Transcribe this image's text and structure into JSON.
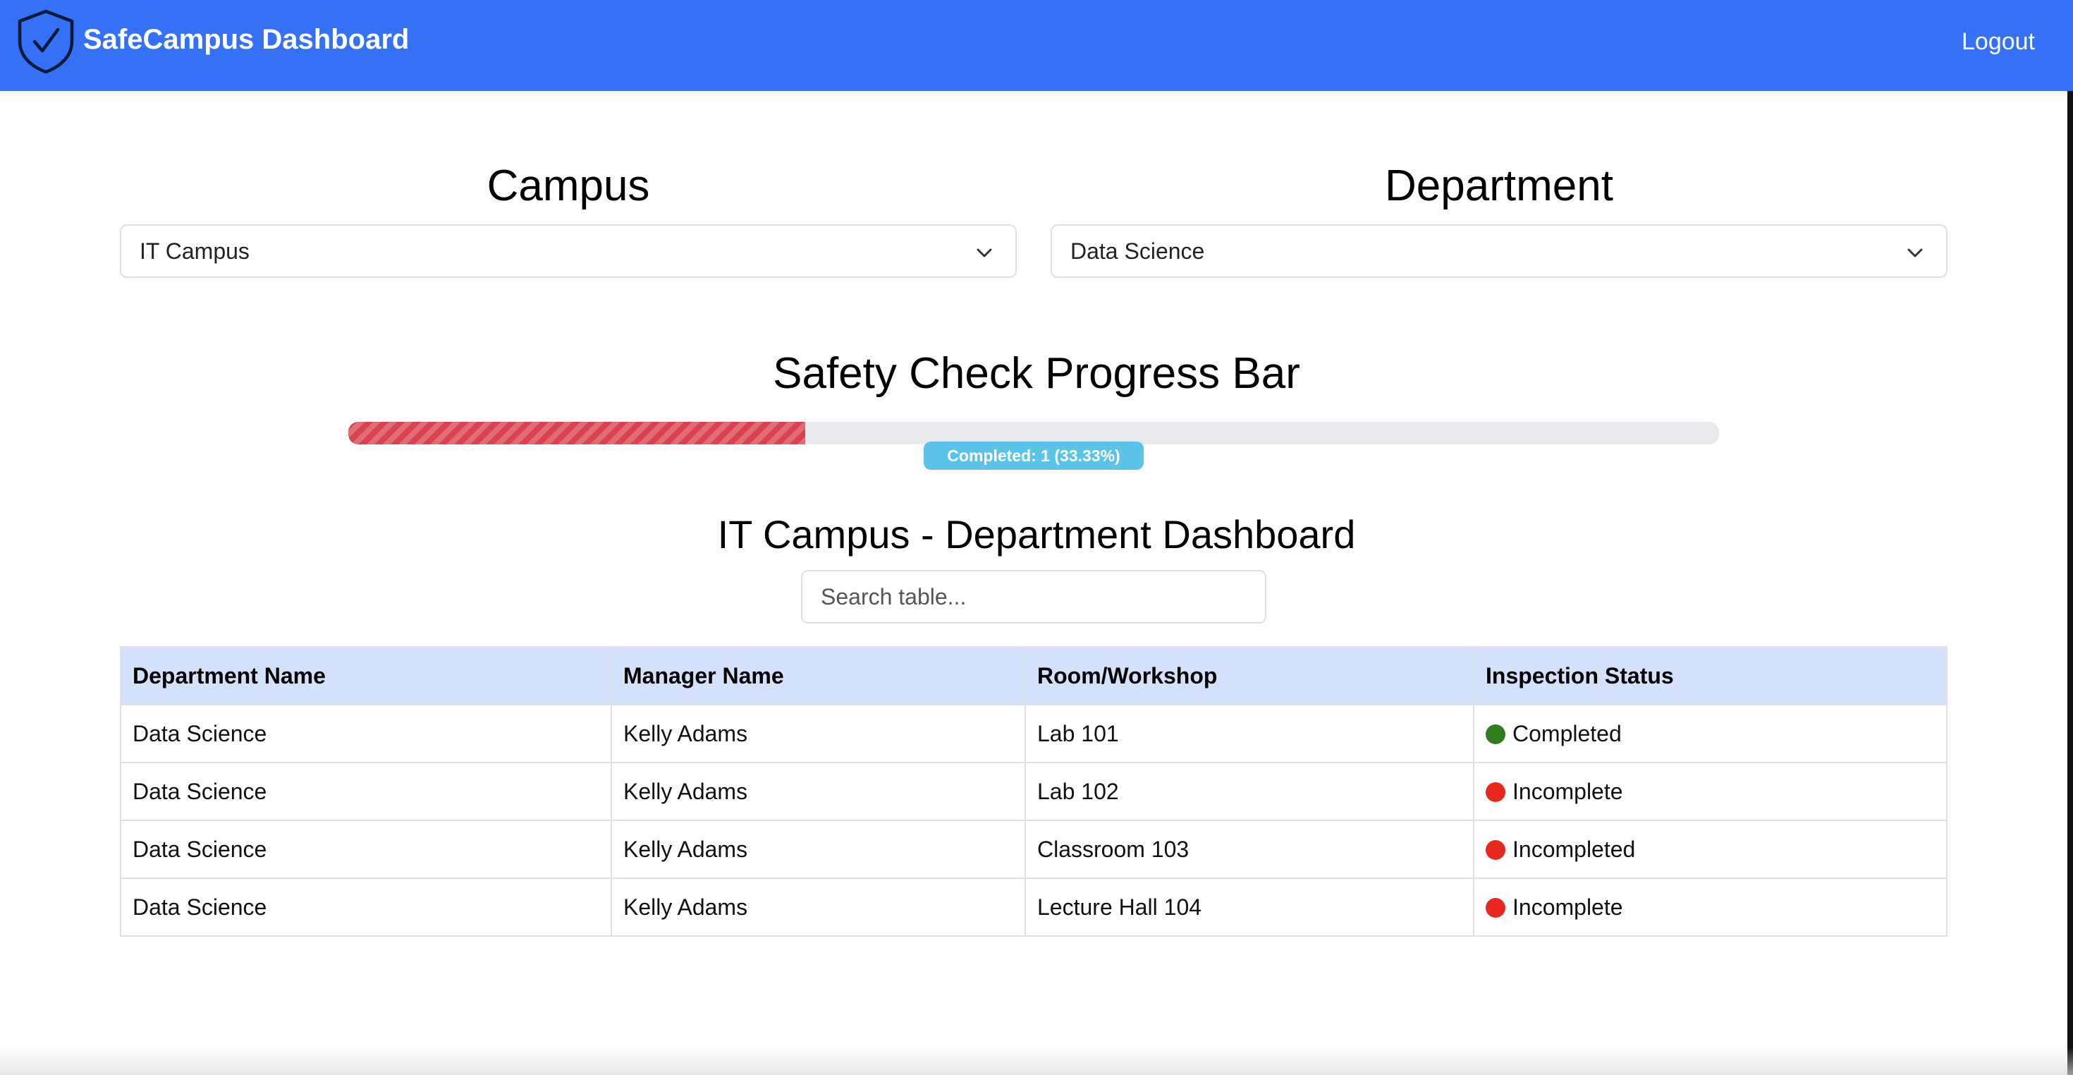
{
  "colors": {
    "navbar": "#3571f6",
    "progress_fill": "#d8434f",
    "badge": "#5bc3e8",
    "table_header": "#d3e1fb",
    "status_completed": "#2f7d1f",
    "status_incomplete": "#e8281f"
  },
  "header": {
    "logo_icon": "shield-check-icon",
    "title": "SafeCampus Dashboard",
    "logout_label": "Logout"
  },
  "filters": {
    "campus": {
      "heading": "Campus",
      "selected": "IT Campus",
      "icon": "chevron-down-icon"
    },
    "department": {
      "heading": "Department",
      "selected": "Data Science",
      "icon": "chevron-down-icon"
    }
  },
  "progress": {
    "title": "Safety Check Progress Bar",
    "fraction": 0.3333,
    "badge_text": "Completed: 1 (33.33%)"
  },
  "dashboard": {
    "title": "IT Campus - Department Dashboard",
    "search_placeholder": "Search table...",
    "search_value": ""
  },
  "table": {
    "headers": [
      "Department Name",
      "Manager Name",
      "Room/Workshop",
      "Inspection Status"
    ],
    "rows": [
      {
        "department": "Data Science",
        "manager": "Kelly Adams",
        "room": "Lab 101",
        "status": "Completed",
        "status_color": "#2f7d1f"
      },
      {
        "department": "Data Science",
        "manager": "Kelly Adams",
        "room": "Lab 102",
        "status": "Incomplete",
        "status_color": "#e8281f"
      },
      {
        "department": "Data Science",
        "manager": "Kelly Adams",
        "room": "Classroom 103",
        "status": "Incompleted",
        "status_color": "#e8281f"
      },
      {
        "department": "Data Science",
        "manager": "Kelly Adams",
        "room": "Lecture Hall 104",
        "status": "Incomplete",
        "status_color": "#e8281f"
      }
    ]
  }
}
